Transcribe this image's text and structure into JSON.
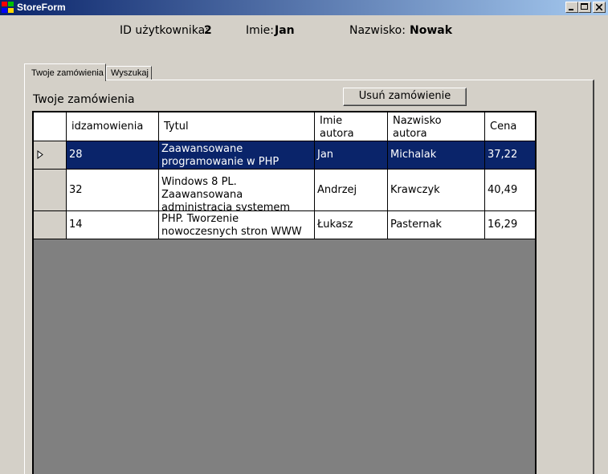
{
  "window": {
    "title": "StoreForm"
  },
  "user": {
    "id_label": "ID użytkownika:",
    "id_value": "2",
    "first_name_label": "Imie:",
    "first_name_value": "Jan",
    "last_name_label": "Nazwisko:",
    "last_name_value": "Nowak"
  },
  "tabs": [
    {
      "label": "Twoje zamówienia",
      "active": true
    },
    {
      "label": "Wyszukaj",
      "active": false
    }
  ],
  "orders": {
    "section_title": "Twoje zamówienia",
    "delete_button": "Usuń zamówienie",
    "columns": [
      "idzamowienia",
      "Tytul",
      "Imie autora",
      "Nazwisko autora",
      "Cena"
    ],
    "rows": [
      {
        "id": "28",
        "title": "Zaawansowane programowanie w PHP",
        "author_first": "Jan",
        "author_last": "Michalak",
        "price": "37,22",
        "selected": true
      },
      {
        "id": "32",
        "title": "Windows 8 PL. Zaawansowana administracja systemem",
        "author_first": "Andrzej",
        "author_last": "Krawczyk",
        "price": "40,49",
        "selected": false
      },
      {
        "id": "14",
        "title": "PHP. Tworzenie nowoczesnych stron WWW",
        "author_first": "Łukasz",
        "author_last": "Pasternak",
        "price": "16,29",
        "selected": false
      }
    ]
  },
  "colors": {
    "titlebar_start": "#0a246a",
    "titlebar_end": "#a6caf0",
    "selection": "#0a246a",
    "grid_background": "#808080",
    "face": "#d4d0c8"
  },
  "icons": [
    "app-icon",
    "minimize-icon",
    "maximize-icon",
    "close-icon",
    "row-indicator-icon"
  ]
}
